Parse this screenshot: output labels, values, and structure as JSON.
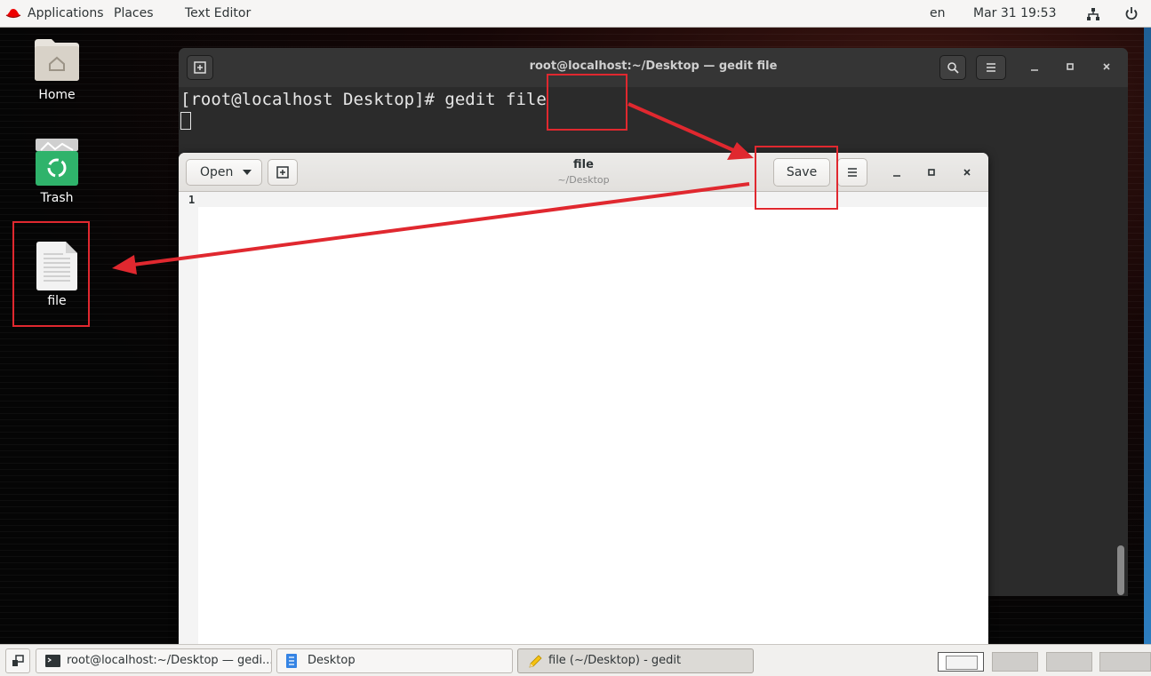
{
  "top_bar": {
    "applications": "Applications",
    "places": "Places",
    "app_name": "Text Editor",
    "language": "en",
    "datetime": "Mar 31 19:53"
  },
  "desktop": {
    "icons": [
      {
        "label": "Home"
      },
      {
        "label": "Trash"
      },
      {
        "label": "file"
      }
    ]
  },
  "terminal": {
    "title": "root@localhost:~/Desktop — gedit file",
    "command_line": "[root@localhost Desktop]# gedit file"
  },
  "gedit": {
    "open_label": "Open",
    "title": "file",
    "subtitle": "~/Desktop",
    "save_label": "Save",
    "line_number": "1"
  },
  "taskbar": {
    "items": [
      {
        "label": "root@localhost:~/Desktop — gedi..."
      },
      {
        "label": "Desktop"
      },
      {
        "label": "file (~/Desktop) - gedit"
      }
    ]
  },
  "colors": {
    "annotation_red": "#e0282f",
    "terminal_bg": "#2b2b2b",
    "panel_bg": "#f6f5f4"
  }
}
